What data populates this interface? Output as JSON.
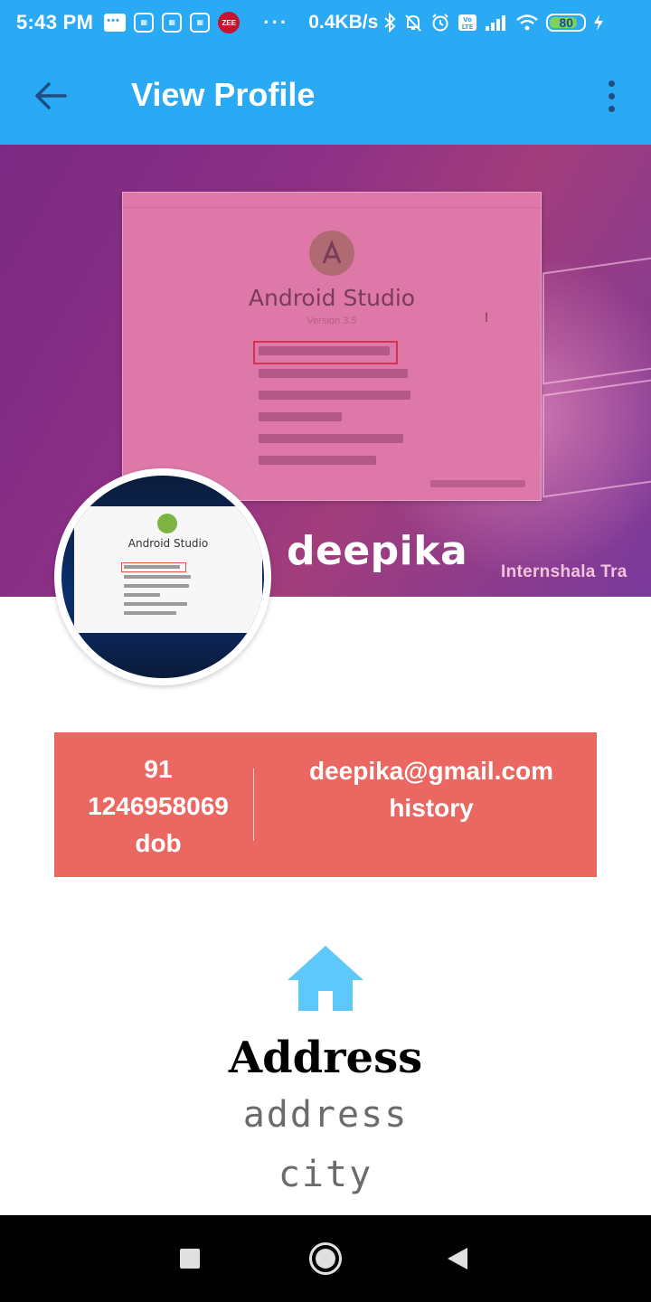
{
  "status_bar": {
    "time": "5:43 PM",
    "network_speed": "0.4KB/s",
    "battery_level": "80",
    "overflow_dots": "···",
    "zee_badge": "ZEE"
  },
  "app_bar": {
    "title": "View Profile"
  },
  "cover": {
    "watermark": "Internshala Tra",
    "screen_title": "Android Studio",
    "screen_version": "Version 3.5"
  },
  "avatar": {
    "screen_title": "Android Studio"
  },
  "profile": {
    "name": "deepika"
  },
  "info_card": {
    "country_code": "91",
    "phone": "1246958069",
    "dob": "dob",
    "email": "deepika@gmail.com",
    "history": "history"
  },
  "address": {
    "heading": "Address",
    "line1": "address",
    "line2": "city"
  },
  "colors": {
    "app_bar": "#2aa9f5",
    "card": "#eb6862",
    "home_icon": "#5ec8fb"
  }
}
